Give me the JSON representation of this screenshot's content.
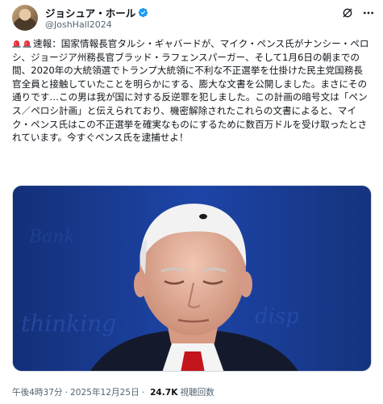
{
  "author": {
    "display_name": "ジョシュア・ホール",
    "handle": "@JoshHall2024",
    "verified_color": "#1d9bf0"
  },
  "tweet": {
    "prefix_icons": [
      "siren-icon",
      "siren-icon"
    ],
    "text": "速報：国家情報長官タルシ・ギャバードが、マイク・ペンス氏がナンシー・ペロシ、ジョージア州務長官ブラッド・ラフェンスパーガー、そして1月6日の朝までの間、2020年の大統領選でトランプ大統領に不利な不正選挙を仕掛けた民主党国務長官全員と接触していたことを明らかにする、膨大な文書を公開しました。まさにその通りです…この男は我が国に対する反逆罪を犯しました。この計画の暗号文は「ペンス／ペロシ計画」と伝えられており、機密解除されたこれらの文書によると、マイク・ペンス氏はこの不正選挙を確実なものにするために数百万ドルを受け取ったとされています。今すぐペンス氏を逮捕せよ！"
  },
  "meta": {
    "time": "午後4時37分",
    "separator": "·",
    "date": "2025年12月25日",
    "separator2": "·",
    "views_count": "24.7K",
    "views_label": "視聴回数"
  },
  "colors": {
    "text": "#0f1419",
    "secondary": "#536471",
    "background_media": "#1b3a8a"
  }
}
